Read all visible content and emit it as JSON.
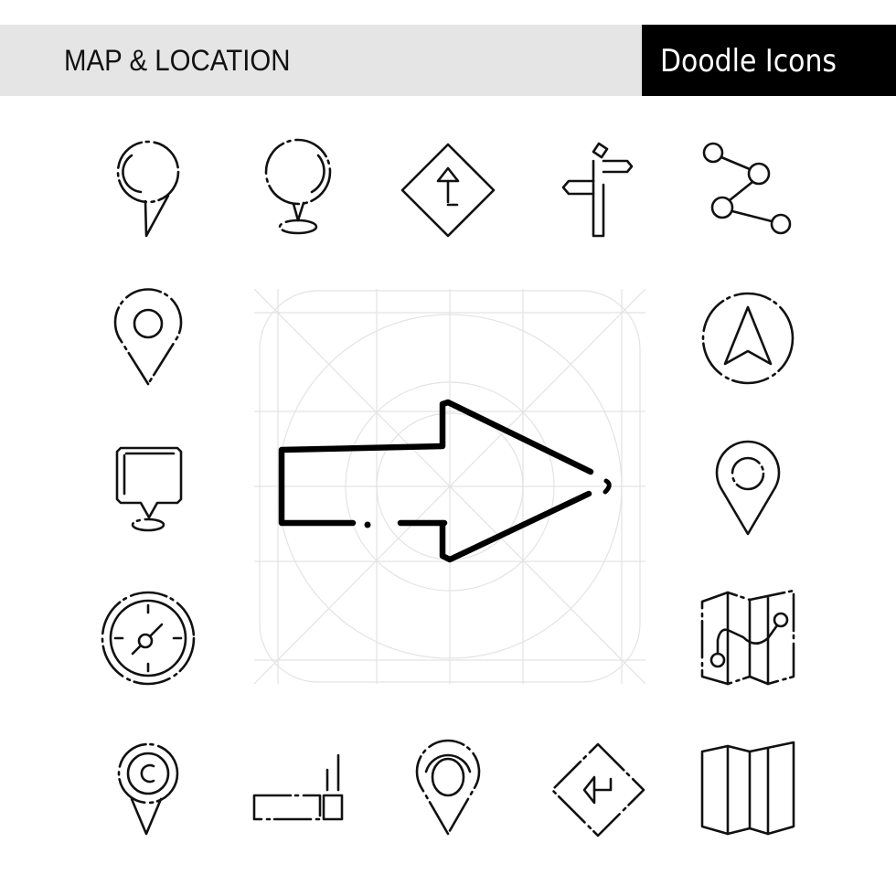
{
  "header": {
    "title": "MAP & LOCATION",
    "badge": "Doodle Icons",
    "colors": {
      "title_bar": "#e5e5e5",
      "badge_bg": "#000000",
      "badge_text": "#ffffff",
      "ink": "#111111"
    }
  },
  "featured_icon": {
    "name": "right-arrow-icon",
    "style": "doodle",
    "grid": "icon-construction-grid"
  },
  "icons": [
    {
      "name": "map-pin-icon",
      "row": 1,
      "col": 1
    },
    {
      "name": "location-pin-base-icon",
      "row": 1,
      "col": 2
    },
    {
      "name": "road-sign-up-arrow-icon",
      "row": 1,
      "col": 3
    },
    {
      "name": "signpost-icon",
      "row": 1,
      "col": 4
    },
    {
      "name": "route-nodes-icon",
      "row": 1,
      "col": 5
    },
    {
      "name": "location-marker-icon",
      "row": 2,
      "col": 1
    },
    {
      "name": "navigation-compass-arrow-icon",
      "row": 2,
      "col": 5
    },
    {
      "name": "square-map-pin-icon",
      "row": 3,
      "col": 1
    },
    {
      "name": "location-marker-alt-icon",
      "row": 3,
      "col": 5
    },
    {
      "name": "compass-icon",
      "row": 4,
      "col": 1
    },
    {
      "name": "folded-map-route-icon",
      "row": 4,
      "col": 5
    },
    {
      "name": "target-pin-icon",
      "row": 5,
      "col": 1
    },
    {
      "name": "barrier-sign-icon",
      "row": 5,
      "col": 2
    },
    {
      "name": "map-marker-icon",
      "row": 5,
      "col": 3
    },
    {
      "name": "road-sign-left-arrow-icon",
      "row": 5,
      "col": 4
    },
    {
      "name": "folded-map-icon",
      "row": 5,
      "col": 5
    }
  ]
}
